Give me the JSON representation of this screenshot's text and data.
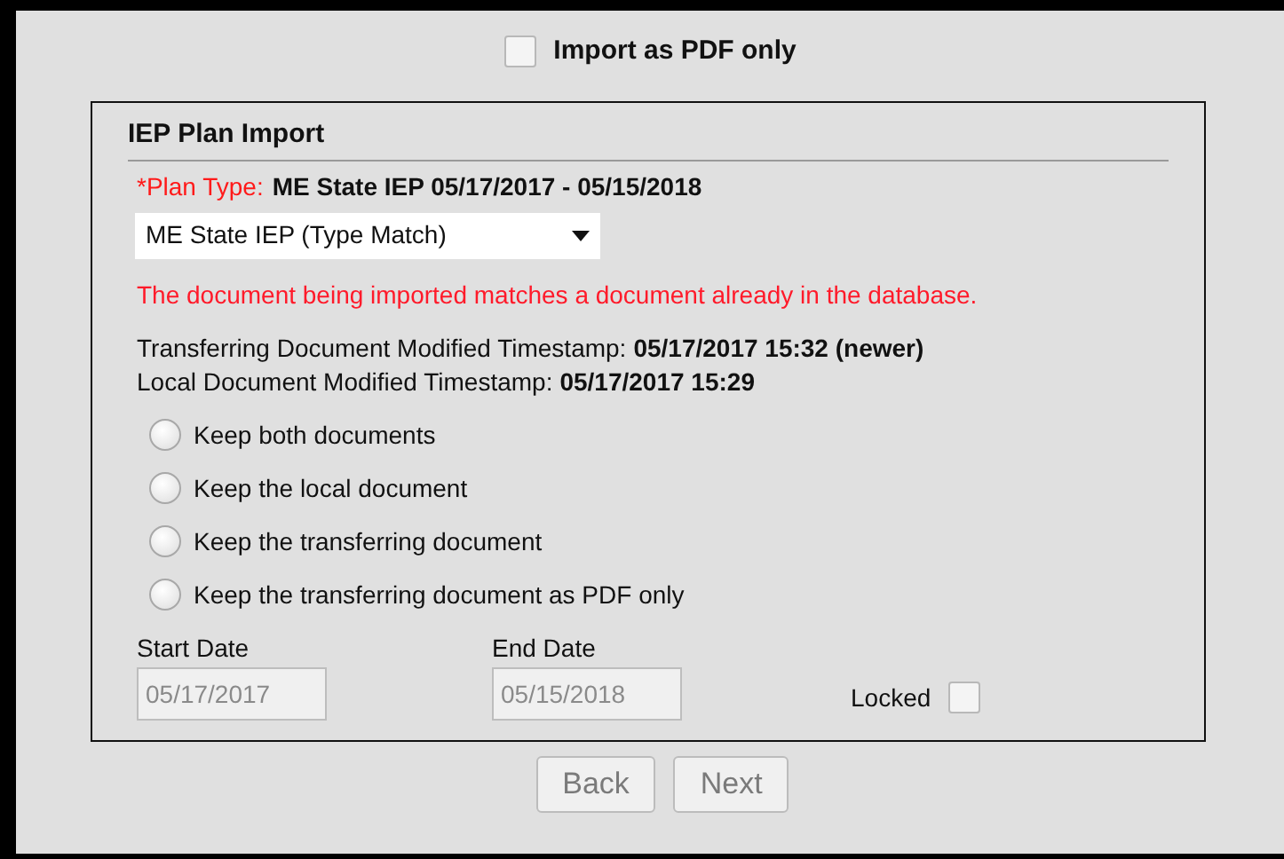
{
  "import_as_pdf_only": {
    "label": "Import as PDF only",
    "checked": false
  },
  "panel": {
    "title": "IEP Plan Import",
    "plan_type": {
      "label": "*Plan Type:",
      "value": "ME State IEP 05/17/2017 - 05/15/2018"
    },
    "plan_select": {
      "value": "ME State IEP (Type Match)"
    },
    "warning": "The document being imported matches a document already in the database.",
    "timestamps": [
      {
        "label": "Transferring Document Modified Timestamp:",
        "value": "05/17/2017 15:32 (newer)"
      },
      {
        "label": "Local Document Modified Timestamp:",
        "value": "05/17/2017 15:29"
      }
    ],
    "options": [
      {
        "label": "Keep both documents",
        "selected": false
      },
      {
        "label": "Keep the local document",
        "selected": false
      },
      {
        "label": "Keep the transferring document",
        "selected": false
      },
      {
        "label": "Keep the transferring document as PDF only",
        "selected": false
      }
    ],
    "start_date": {
      "label": "Start Date",
      "value": "05/17/2017",
      "disabled": true
    },
    "end_date": {
      "label": "End Date",
      "value": "05/15/2018",
      "disabled": true
    },
    "locked": {
      "label": "Locked",
      "checked": false
    }
  },
  "buttons": [
    {
      "label": "Back",
      "disabled": true
    },
    {
      "label": "Next",
      "disabled": true
    }
  ]
}
